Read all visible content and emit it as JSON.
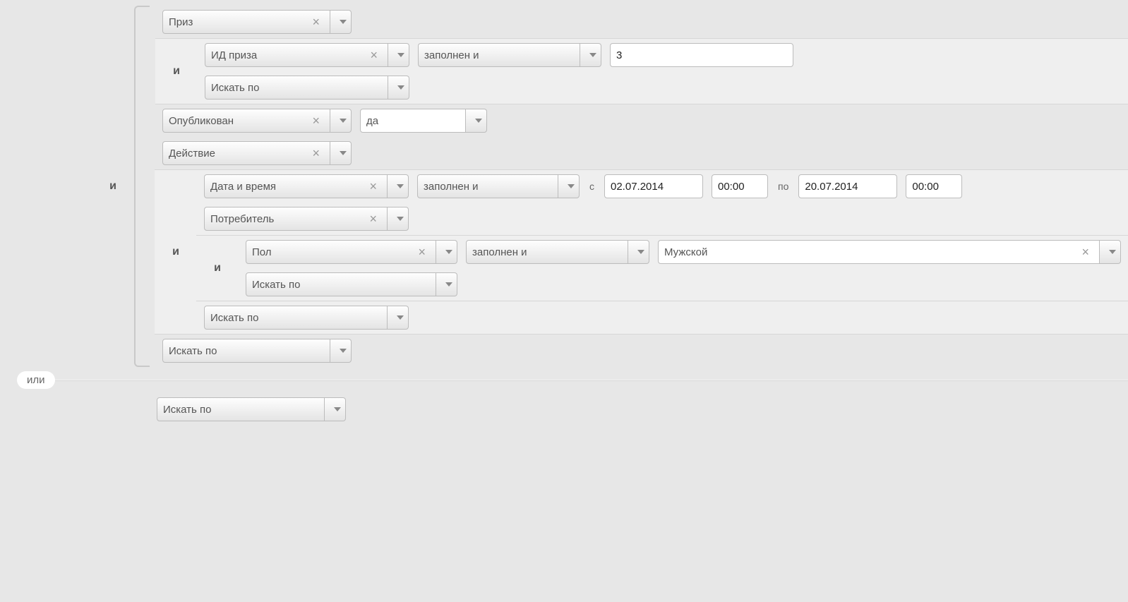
{
  "labels": {
    "and": "и",
    "or": "или",
    "from": "с",
    "to": "по",
    "search_by": "Искать по"
  },
  "g1": {
    "prize": "Приз",
    "prize_id": "ИД приза",
    "filled_and": "заполнен и",
    "prize_id_val": "3",
    "published": "Опубликован",
    "published_val": "да",
    "action": "Действие",
    "datetime": "Дата и время",
    "date_from": "02.07.2014",
    "time_from": "00:00",
    "date_to": "20.07.2014",
    "time_to": "00:00",
    "consumer": "Потребитель",
    "gender": "Пол",
    "gender_val": "Мужской"
  }
}
